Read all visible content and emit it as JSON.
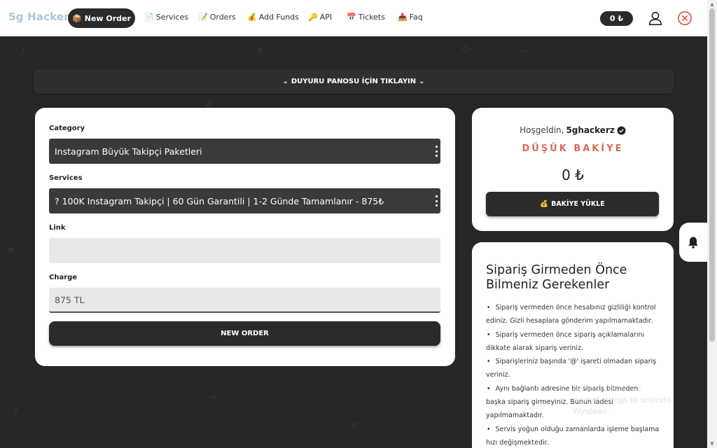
{
  "nav": {
    "brand": "5g Hackerz",
    "new_order": "New Order",
    "services": "Services",
    "orders": "Orders",
    "add_funds": "Add Funds",
    "api": "API",
    "tickets": "Tickets",
    "faq": "Faq",
    "balance": "0 ₺"
  },
  "announcement": "DUYURU PANOSU İÇİN TIKLAYIN",
  "order_form": {
    "category_label": "Category",
    "category_value": "Instagram Büyük Takipçi Paketleri",
    "services_label": "Services",
    "services_value": "? 100K Instagram Takipçi | 60 Gün Garantili | 1-2 Günde Tamamlanır - 875₺",
    "link_label": "Link",
    "link_value": "",
    "charge_label": "Charge",
    "charge_value": "875 TL",
    "submit": "NEW ORDER"
  },
  "welcome": {
    "greeting": "Hoşgeldin,",
    "username": "5ghackerz",
    "status": "DÜŞÜK BAKİYE",
    "balance": "0 ₺",
    "topup": "BAKİYE YÜKLE"
  },
  "info": {
    "title": "Sipariş Girmeden Önce Bilmeniz Gerekenler",
    "items": [
      "Sipariş vermeden önce hesabınız gizliliği kontrol ediniz. Gizli hesaplara gönderim yapılmamaktadır.",
      "Sipariş vermeden önce sipariş açıklamalarını dikkate alarak sipariş veriniz.",
      "Siparişleriniz başında '@' işareti olmadan sipariş veriniz.",
      "Aynı bağlantı adresine bir sipariş bitmeden başka sipariş girmeyiniz. Bunun iadesi yapılmamaktadır.",
      "Servis yoğun olduğu zamanlarda işleme başlama hızı değişmektedir."
    ]
  },
  "watermark": "Activate Windows\nGo to Settings to activate Windows.",
  "colors": {
    "background": "#262626",
    "dark": "#2b2b2b",
    "low_balance": "#d86a5c",
    "close": "#e05545",
    "brand": "#a9c8dc"
  },
  "icons": {
    "new_order": "package-icon",
    "services": "document-icon",
    "orders": "edit-icon",
    "add_funds": "money-bag-icon",
    "api": "key-icon",
    "tickets": "calendar-icon",
    "faq": "inbox-icon",
    "user": "user-icon",
    "close": "close-circle-icon",
    "verified": "verified-icon",
    "bell": "bell-icon"
  }
}
